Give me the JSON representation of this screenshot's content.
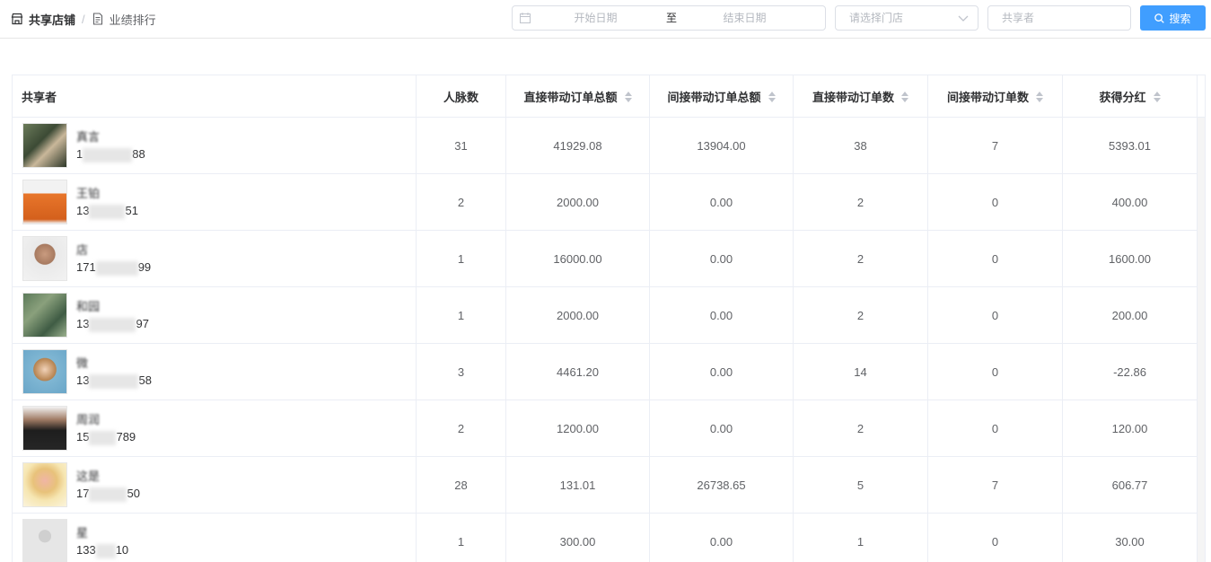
{
  "breadcrumb": {
    "first": "共享店铺",
    "separator": "/",
    "current": "业绩排行"
  },
  "filters": {
    "start_placeholder": "开始日期",
    "range_separator": "至",
    "end_placeholder": "结束日期",
    "store_placeholder": "请选择门店",
    "sharer_placeholder": "共享者",
    "search_label": "搜索"
  },
  "colors": {
    "primary": "#409eff",
    "border": "#ebeef5",
    "header_text": "#303133",
    "cell_text": "#606266"
  },
  "table": {
    "columns": [
      {
        "label": "共享者",
        "sortable": false
      },
      {
        "label": "人脉数",
        "sortable": false
      },
      {
        "label": "直接带动订单总额",
        "sortable": true
      },
      {
        "label": "间接带动订单总额",
        "sortable": true
      },
      {
        "label": "直接带动订单数",
        "sortable": true
      },
      {
        "label": "间接带动订单数",
        "sortable": true
      },
      {
        "label": "获得分红",
        "sortable": true
      }
    ],
    "rows": [
      {
        "name": "真言",
        "phone_head": "1",
        "phone_tail": "88",
        "contacts": "31",
        "direct_amount": "41929.08",
        "indirect_amount": "13904.00",
        "direct_count": "38",
        "indirect_count": "7",
        "dividend": "5393.01"
      },
      {
        "name": "王铂",
        "phone_head": "13",
        "phone_tail": "51",
        "contacts": "2",
        "direct_amount": "2000.00",
        "indirect_amount": "0.00",
        "direct_count": "2",
        "indirect_count": "0",
        "dividend": "400.00"
      },
      {
        "name": "店",
        "phone_head": "171",
        "phone_tail": "99",
        "contacts": "1",
        "direct_amount": "16000.00",
        "indirect_amount": "0.00",
        "direct_count": "2",
        "indirect_count": "0",
        "dividend": "1600.00"
      },
      {
        "name": "和园",
        "phone_head": "13",
        "phone_tail": "97",
        "contacts": "1",
        "direct_amount": "2000.00",
        "indirect_amount": "0.00",
        "direct_count": "2",
        "indirect_count": "0",
        "dividend": "200.00"
      },
      {
        "name": "微",
        "phone_head": "13",
        "phone_tail": "58",
        "contacts": "3",
        "direct_amount": "4461.20",
        "indirect_amount": "0.00",
        "direct_count": "14",
        "indirect_count": "0",
        "dividend": "-22.86"
      },
      {
        "name": "周润",
        "phone_head": "15",
        "phone_tail": "789",
        "contacts": "2",
        "direct_amount": "1200.00",
        "indirect_amount": "0.00",
        "direct_count": "2",
        "indirect_count": "0",
        "dividend": "120.00"
      },
      {
        "name": "这是",
        "phone_head": "17",
        "phone_tail": "50",
        "contacts": "28",
        "direct_amount": "131.01",
        "indirect_amount": "26738.65",
        "direct_count": "5",
        "indirect_count": "7",
        "dividend": "606.77"
      },
      {
        "name": "星",
        "phone_head": "133",
        "phone_tail": "10",
        "contacts": "1",
        "direct_amount": "300.00",
        "indirect_amount": "0.00",
        "direct_count": "1",
        "indirect_count": "0",
        "dividend": "30.00"
      }
    ]
  }
}
